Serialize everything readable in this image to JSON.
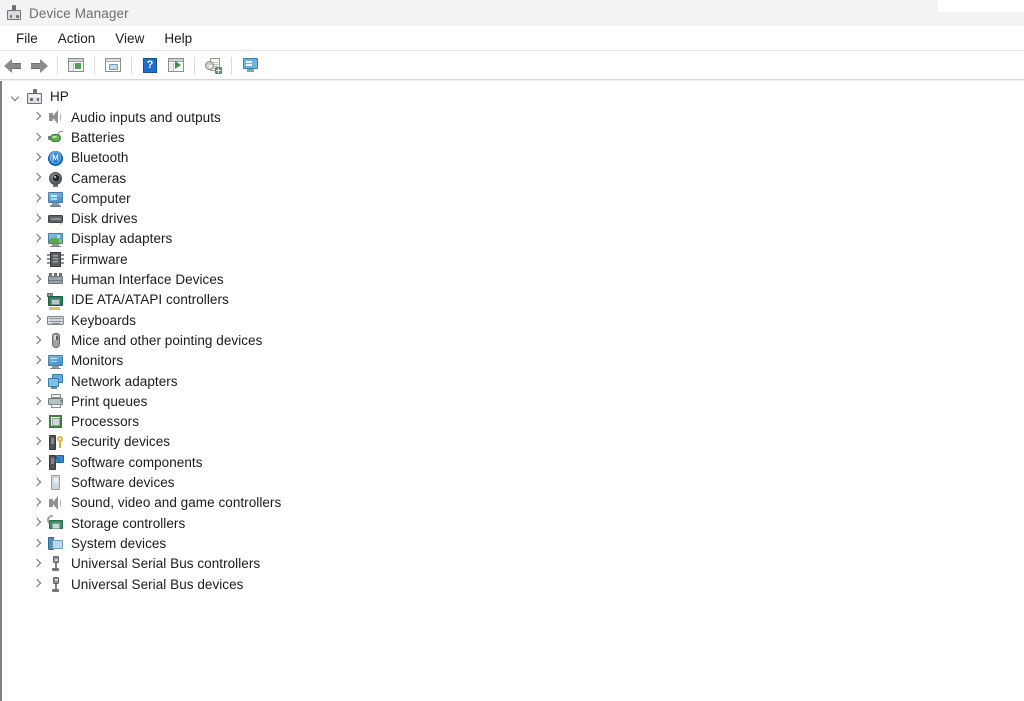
{
  "window": {
    "title": "Device Manager",
    "title_icon": "device-manager-icon"
  },
  "menubar": {
    "items": [
      {
        "label": "File"
      },
      {
        "label": "Action"
      },
      {
        "label": "View"
      },
      {
        "label": "Help"
      }
    ]
  },
  "toolbar": {
    "buttons": [
      {
        "name": "back-button",
        "icon": "back-arrow-icon"
      },
      {
        "name": "forward-button",
        "icon": "forward-arrow-icon"
      },
      {
        "name": "show-console-tree-button",
        "icon": "console-tree-icon"
      },
      {
        "name": "properties-button",
        "icon": "properties-icon"
      },
      {
        "name": "help-button",
        "icon": "help-icon"
      },
      {
        "name": "update-driver-button",
        "icon": "update-driver-icon"
      },
      {
        "name": "scan-hardware-changes-button",
        "icon": "scan-hardware-icon"
      },
      {
        "name": "show-hidden-devices-button",
        "icon": "show-hidden-devices-icon"
      }
    ]
  },
  "tree": {
    "root": {
      "label": "HP",
      "icon": "computer-tower-icon",
      "expanded": true,
      "chevron": "chevron-down-icon"
    },
    "nodes": [
      {
        "label": "Audio inputs and outputs",
        "icon": "speaker-icon",
        "chevron": "chevron-right-icon",
        "expanded": false
      },
      {
        "label": "Batteries",
        "icon": "battery-icon",
        "chevron": "chevron-right-icon",
        "expanded": false
      },
      {
        "label": "Bluetooth",
        "icon": "bluetooth-icon",
        "chevron": "chevron-right-icon",
        "expanded": false
      },
      {
        "label": "Cameras",
        "icon": "camera-icon",
        "chevron": "chevron-right-icon",
        "expanded": false
      },
      {
        "label": "Computer",
        "icon": "monitor-icon",
        "chevron": "chevron-right-icon",
        "expanded": false
      },
      {
        "label": "Disk drives",
        "icon": "disk-drive-icon",
        "chevron": "chevron-right-icon",
        "expanded": false
      },
      {
        "label": "Display adapters",
        "icon": "display-adapter-icon",
        "chevron": "chevron-right-icon",
        "expanded": false
      },
      {
        "label": "Firmware",
        "icon": "firmware-chip-icon",
        "chevron": "chevron-right-icon",
        "expanded": false
      },
      {
        "label": "Human Interface Devices",
        "icon": "hid-board-icon",
        "chevron": "chevron-right-icon",
        "expanded": false
      },
      {
        "label": "IDE ATA/ATAPI controllers",
        "icon": "ide-controller-icon",
        "chevron": "chevron-right-icon",
        "expanded": false
      },
      {
        "label": "Keyboards",
        "icon": "keyboard-icon",
        "chevron": "chevron-right-icon",
        "expanded": false
      },
      {
        "label": "Mice and other pointing devices",
        "icon": "mouse-icon",
        "chevron": "chevron-right-icon",
        "expanded": false
      },
      {
        "label": "Monitors",
        "icon": "monitor-icon",
        "chevron": "chevron-right-icon",
        "expanded": false
      },
      {
        "label": "Network adapters",
        "icon": "network-adapter-icon",
        "chevron": "chevron-right-icon",
        "expanded": false
      },
      {
        "label": "Print queues",
        "icon": "printer-icon",
        "chevron": "chevron-right-icon",
        "expanded": false
      },
      {
        "label": "Processors",
        "icon": "processor-icon",
        "chevron": "chevron-right-icon",
        "expanded": false
      },
      {
        "label": "Security devices",
        "icon": "security-device-icon",
        "chevron": "chevron-right-icon",
        "expanded": false
      },
      {
        "label": "Software components",
        "icon": "software-component-icon",
        "chevron": "chevron-right-icon",
        "expanded": false
      },
      {
        "label": "Software devices",
        "icon": "software-device-icon",
        "chevron": "chevron-right-icon",
        "expanded": false
      },
      {
        "label": "Sound, video and game controllers",
        "icon": "speaker-icon",
        "chevron": "chevron-right-icon",
        "expanded": false
      },
      {
        "label": "Storage controllers",
        "icon": "storage-controller-icon",
        "chevron": "chevron-right-icon",
        "expanded": false
      },
      {
        "label": "System devices",
        "icon": "system-device-icon",
        "chevron": "chevron-right-icon",
        "expanded": false
      },
      {
        "label": "Universal Serial Bus controllers",
        "icon": "usb-icon",
        "chevron": "chevron-right-icon",
        "expanded": false
      },
      {
        "label": "Universal Serial Bus devices",
        "icon": "usb-icon",
        "chevron": "chevron-right-icon",
        "expanded": false
      }
    ]
  },
  "colors": {
    "titlebar_bg": "#f3f3f3",
    "title_text": "#6e6e6e",
    "menu_text": "#1b1b1b",
    "tree_text": "#1b1b1b",
    "pane_border": "#808080",
    "accent_blue": "#1477d1",
    "accent_green": "#4fa14f"
  }
}
